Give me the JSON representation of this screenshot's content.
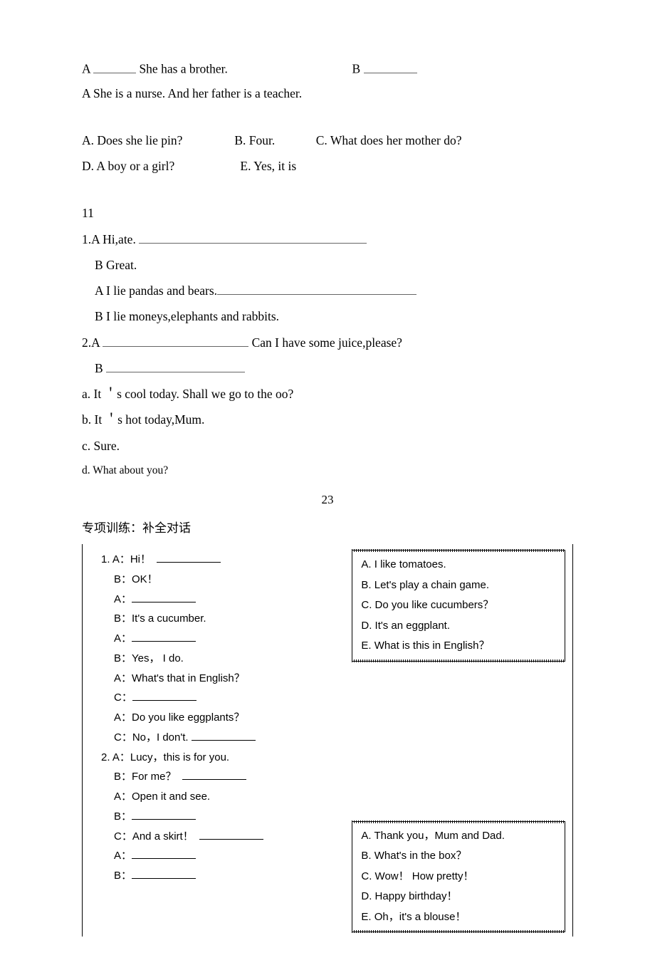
{
  "top": {
    "row1_left_pre": "A ",
    "row1_left_post": " She has a brother.",
    "row1_right": "B ",
    "row2": "A She is a nurse. And her father is a teacher.",
    "opt_a": "A.  Does she lie pin?",
    "opt_b": "B. Four.",
    "opt_c": "C. What does her mother do?",
    "opt_d": "D. A boy or a girl?",
    "opt_e": "E. Yes, it is"
  },
  "sec11": {
    "num": "11",
    "l1_pre": "1.A Hi,ate. ",
    "l1_b": "B Great.",
    "l1_a2_pre": "A I lie pandas and bears.",
    "l1_b2": "B I lie moneys,elephants and rabbits.",
    "l2_pre": "2.A ",
    "l2_post": " Can I have some juice,please?",
    "l2_b": "B ",
    "oa": "a.   It ＇s cool today. Shall we go to the oo?",
    "ob": "b.   It ＇s hot today,Mum.",
    "oc": "c.   Sure.",
    "od": "d.   What about you?"
  },
  "page_num": "23",
  "sec_title": "专项训练：补全对话",
  "ex1": {
    "q1_a1": "1. A：Hi！  ",
    "b1": "B：OK！",
    "a2": "A：",
    "b2": "B：It's a cucumber.",
    "a3": "A：",
    "b3": "B：Yes， I do.",
    "a4": "A：What's that in English？",
    "c1": "C：",
    "a5": "A：Do you like eggplants？",
    "c2": "C：No，I don't. ",
    "q2_a1": "2. A：Lucy，this is for you.",
    "b4": "B：For me？  ",
    "a6": "A：Open it and see.",
    "b5": "B：",
    "c3": "C：And a skirt！  ",
    "a7": "A：",
    "b6": "B："
  },
  "box1": {
    "a": "A. I like tomatoes.",
    "b": "B. Let's play a chain game.",
    "c": "C. Do you like cucumbers？",
    "d": "D. It's an eggplant.",
    "e": "E. What is this in English？"
  },
  "box2": {
    "a": "A. Thank you，Mum and Dad.",
    "b": "B. What's in the box？",
    "c": "C. Wow！  How pretty！",
    "d": "D. Happy birthday！",
    "e": "E. Oh，it's a blouse！"
  }
}
